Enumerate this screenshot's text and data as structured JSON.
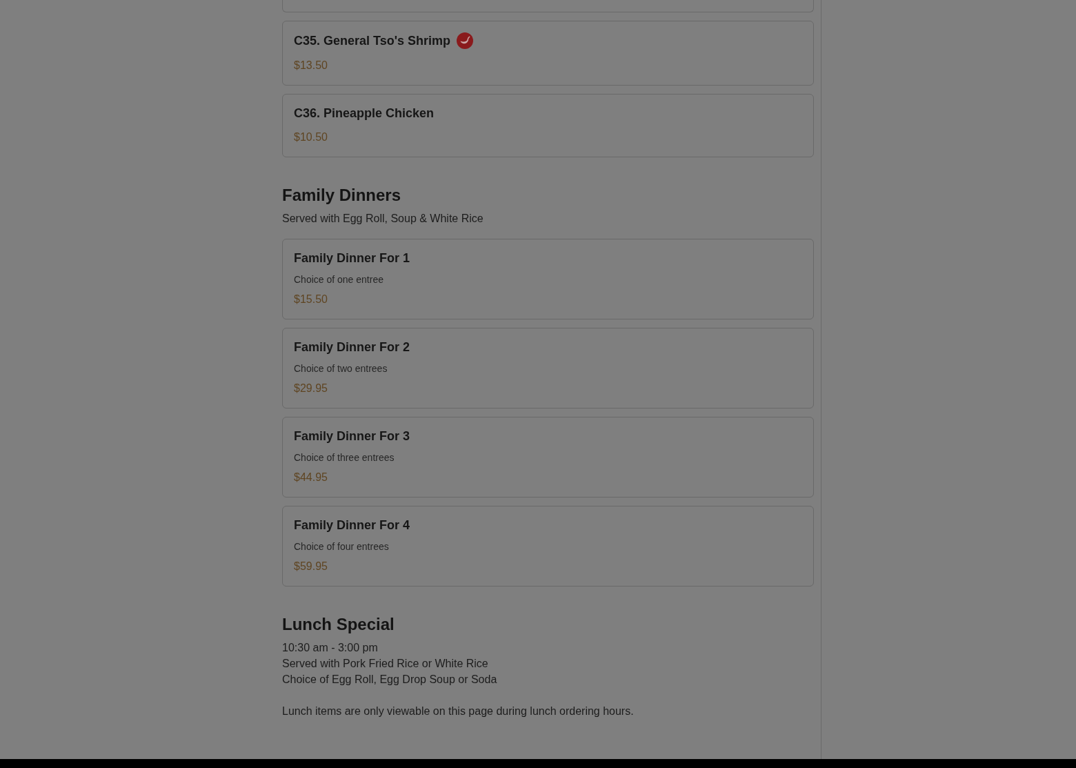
{
  "menu": {
    "sections": [
      {
        "items": [
          {
            "name": "C35. General Tso's Shrimp",
            "spicy": true,
            "price": "$13.50"
          },
          {
            "name": "C36. Pineapple Chicken",
            "spicy": false,
            "price": "$10.50"
          }
        ]
      },
      {
        "title": "Family Dinners",
        "notes": [
          "Served with Egg Roll, Soup & White Rice"
        ],
        "items": [
          {
            "name": "Family Dinner For 1",
            "spicy": false,
            "description": "Choice of one entree",
            "price": "$15.50"
          },
          {
            "name": "Family Dinner For 2",
            "spicy": false,
            "description": "Choice of two entrees",
            "price": "$29.95"
          },
          {
            "name": "Family Dinner For 3",
            "spicy": false,
            "description": "Choice of three entrees",
            "price": "$44.95"
          },
          {
            "name": "Family Dinner For 4",
            "spicy": false,
            "description": "Choice of four entrees",
            "price": "$59.95"
          }
        ]
      },
      {
        "title": "Lunch Special",
        "notes": [
          "10:30 am - 3:00 pm",
          "Served with Pork Fried Rice or White Rice",
          "Choice of Egg Roll, Egg Drop Soup or Soda"
        ],
        "notice": "Lunch items are only viewable on this page during lunch ordering hours."
      }
    ]
  }
}
